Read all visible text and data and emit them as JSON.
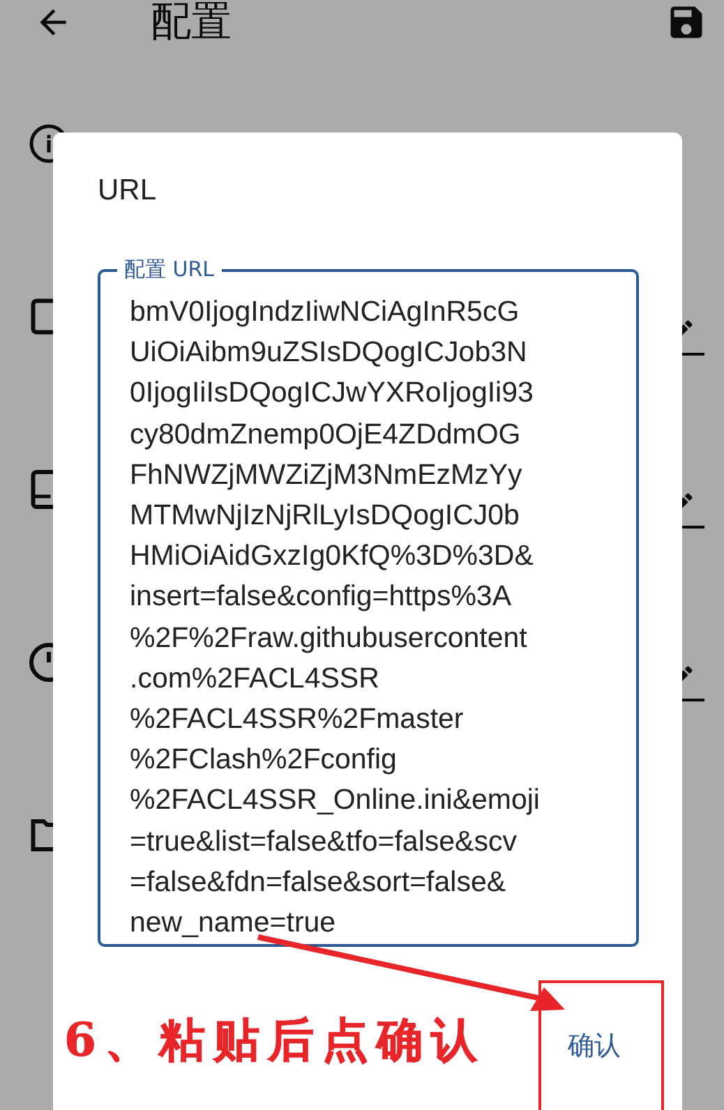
{
  "toolbar": {
    "title": "配置"
  },
  "rows": [
    {
      "kind": "info",
      "editable": false
    },
    {
      "kind": "square",
      "editable": true
    },
    {
      "kind": "tablet",
      "editable": true
    },
    {
      "kind": "clock",
      "editable": true
    },
    {
      "kind": "folder",
      "editable": false
    }
  ],
  "dialog": {
    "title": "URL",
    "field": {
      "label": "配置 URL",
      "lines": [
        "bmV0IjogIndzIiwNCiAgInR5cG",
        "UiOiAibm9uZSIsDQogICJob3N",
        "0IjogIiIsDQogICJwYXRoIjogIi93",
        "cy80dmZnemp0OjE4ZDdmOG",
        "FhNWZjMWZiZjM3NmEzMzYy",
        "MTMwNjIzNjRlLyIsDQogICJ0b",
        "HMiOiAidGxzIg0KfQ%3D%3D&",
        "insert=false&config=https%3A",
        "%2F%2Fraw.githubusercontent",
        ".com%2FACL4SSR",
        "%2FACL4SSR%2Fmaster",
        "%2FClash%2Fconfig",
        "%2FACL4SSR_Online.ini&emoji",
        "=true&list=false&tfo=false&scv",
        "=false&fdn=false&sort=false&",
        "new_name=true"
      ]
    },
    "buttons": [
      "确认"
    ]
  },
  "annotation": {
    "text": "6、粘贴后点确认"
  }
}
